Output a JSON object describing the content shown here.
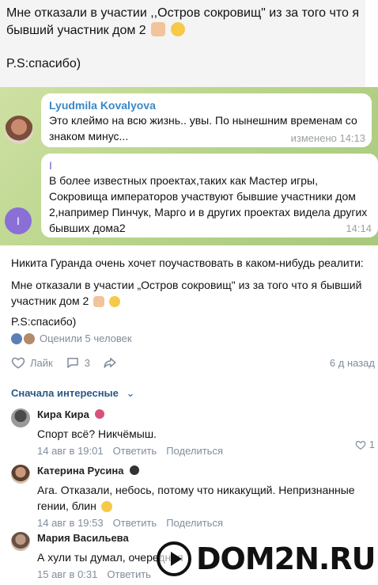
{
  "quote": {
    "message": "Мне отказали в участии ,,Остров сокровищ\" из за того что я бывший участник дом 2",
    "ps": "P.S:спасибо)"
  },
  "chat": {
    "msg1": {
      "author": "Lyudmila Kovalyova",
      "text": "Это клеймо на всю жизнь.. увы. По нынешним временам со знаком минус...",
      "time": "изменено 14:13"
    },
    "msg2": {
      "author": "I",
      "text": "В более известных проектах,таких как Мастер игры, Сокровища императоров участвуют бывшие участники дом 2,например Пинчук, Марго и в других проектах видела других бывших дома2",
      "time": "14:14",
      "avatar_letter": "I"
    }
  },
  "post": {
    "author_line": "Никита Гуранда очень хочет поучаствовать в каком-нибудь реалити:",
    "message": "Мне отказали в участии „Остров сокровищ\" из за того что я бывший участник дом 2",
    "ps": "P.S:спасибо)",
    "rated": "Оценили 5 человек",
    "like_label": "Лайк",
    "comments_count": "3",
    "date": "6 д назад"
  },
  "comments_sort": "Сначала интересные",
  "comments": [
    {
      "name": "Кира Кира",
      "text": "Спорт всё? Никчёмыш.",
      "date": "14 авг в 19:01",
      "reply": "Ответить",
      "share": "Поделиться",
      "likes": "1"
    },
    {
      "name": "Катерина Русина",
      "text": "Ага. Отказали, небось, потому что никакущий. Непризнанные гении, блин",
      "date": "14 авг в 19:53",
      "reply": "Ответить",
      "share": "Поделиться"
    },
    {
      "name": "Мария Васильева",
      "text": "А хули ты думал, очередная",
      "date": "15 авг в 0:31",
      "reply": "Ответить"
    }
  ],
  "watermark": "DOM2N.RU",
  "colors": {
    "link": "#2a5885",
    "meta": "#818c99",
    "telegram_author": "#3a88c6",
    "chat_bg": "#b7d48a"
  }
}
